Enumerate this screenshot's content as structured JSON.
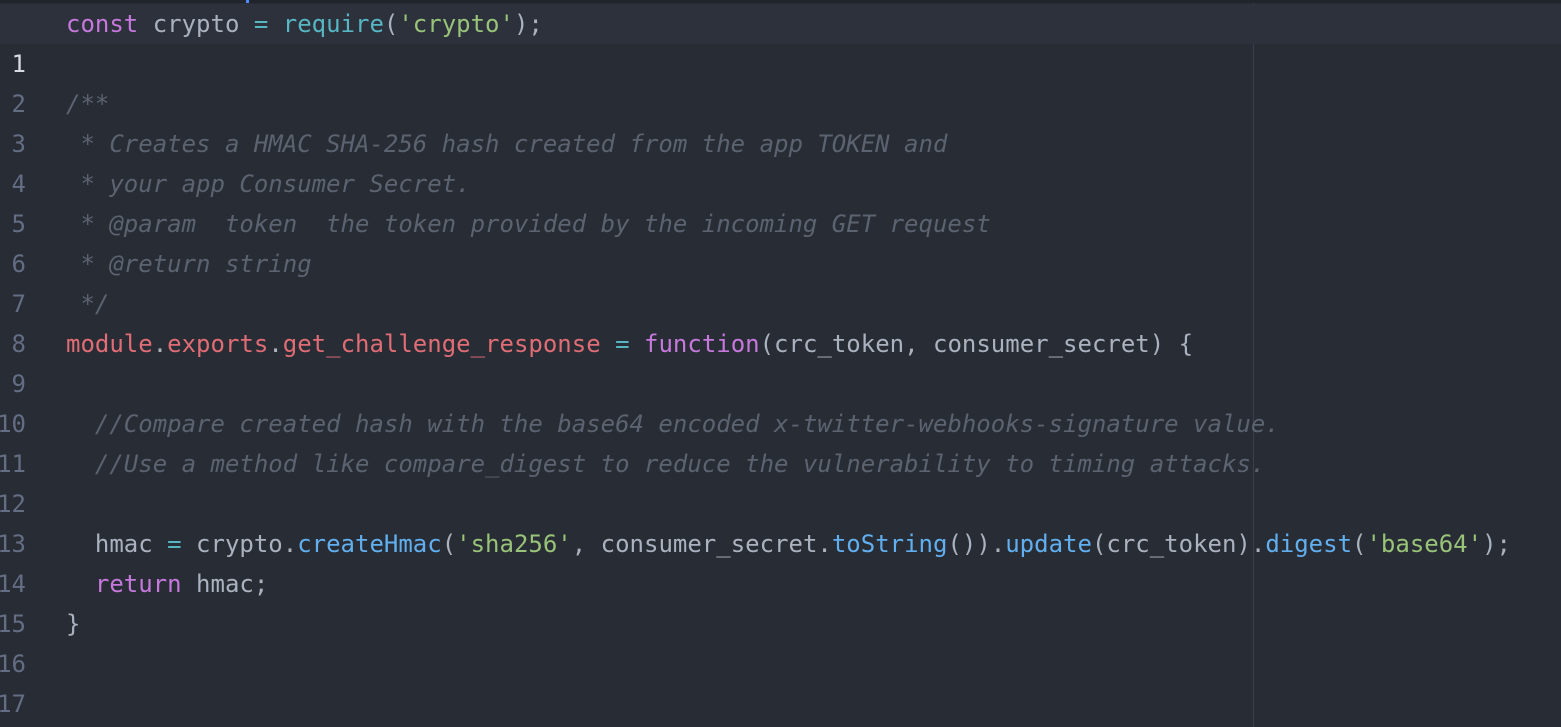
{
  "editor": {
    "colors": {
      "background": "#282c34",
      "keyword": "#c678dd",
      "function": "#61afef",
      "string": "#98c379",
      "property": "#e06c75",
      "operator": "#56b6c2",
      "comment": "#5c6370",
      "text": "#abb2bf",
      "line_number": "#636d83"
    },
    "lines": [
      {
        "n": "1"
      },
      {
        "n": "2"
      },
      {
        "n": "3"
      },
      {
        "n": "4"
      },
      {
        "n": "5"
      },
      {
        "n": "6"
      },
      {
        "n": "7"
      },
      {
        "n": "8"
      },
      {
        "n": "9"
      },
      {
        "n": "10"
      },
      {
        "n": "11"
      },
      {
        "n": "12"
      },
      {
        "n": "13"
      },
      {
        "n": "14"
      },
      {
        "n": "15"
      },
      {
        "n": "16"
      },
      {
        "n": "17"
      }
    ],
    "tokens": {
      "l1": [
        "const",
        " crypto ",
        "=",
        " ",
        "require",
        "(",
        "'crypto'",
        ");"
      ],
      "l3": [
        "/**"
      ],
      "l4": [
        " * Creates a HMAC SHA-256 hash created from the app TOKEN and"
      ],
      "l5": [
        " * your app Consumer Secret."
      ],
      "l6": [
        " * @param  token  the token provided by the incoming GET request"
      ],
      "l7": [
        " * @return string"
      ],
      "l8": [
        " */"
      ],
      "l9": [
        "module",
        ".",
        "exports",
        ".",
        "get_challenge_response",
        " ",
        "=",
        " ",
        "function",
        "(crc_token, consumer_secret) {"
      ],
      "l11": [
        "  //Compare created hash with the base64 encoded x-twitter-webhooks-signature value."
      ],
      "l12": [
        "  //Use a method like compare_digest to reduce the vulnerability to timing attacks."
      ],
      "l14": [
        "  hmac ",
        "=",
        " crypto.",
        "createHmac",
        "(",
        "'sha256'",
        ", consumer_secret.",
        "toString",
        "()).",
        "update",
        "(crc_token).",
        "digest",
        "(",
        "'base64'",
        ");"
      ],
      "l15": [
        "  ",
        "return",
        " hmac;"
      ],
      "l16": [
        "}"
      ]
    }
  }
}
